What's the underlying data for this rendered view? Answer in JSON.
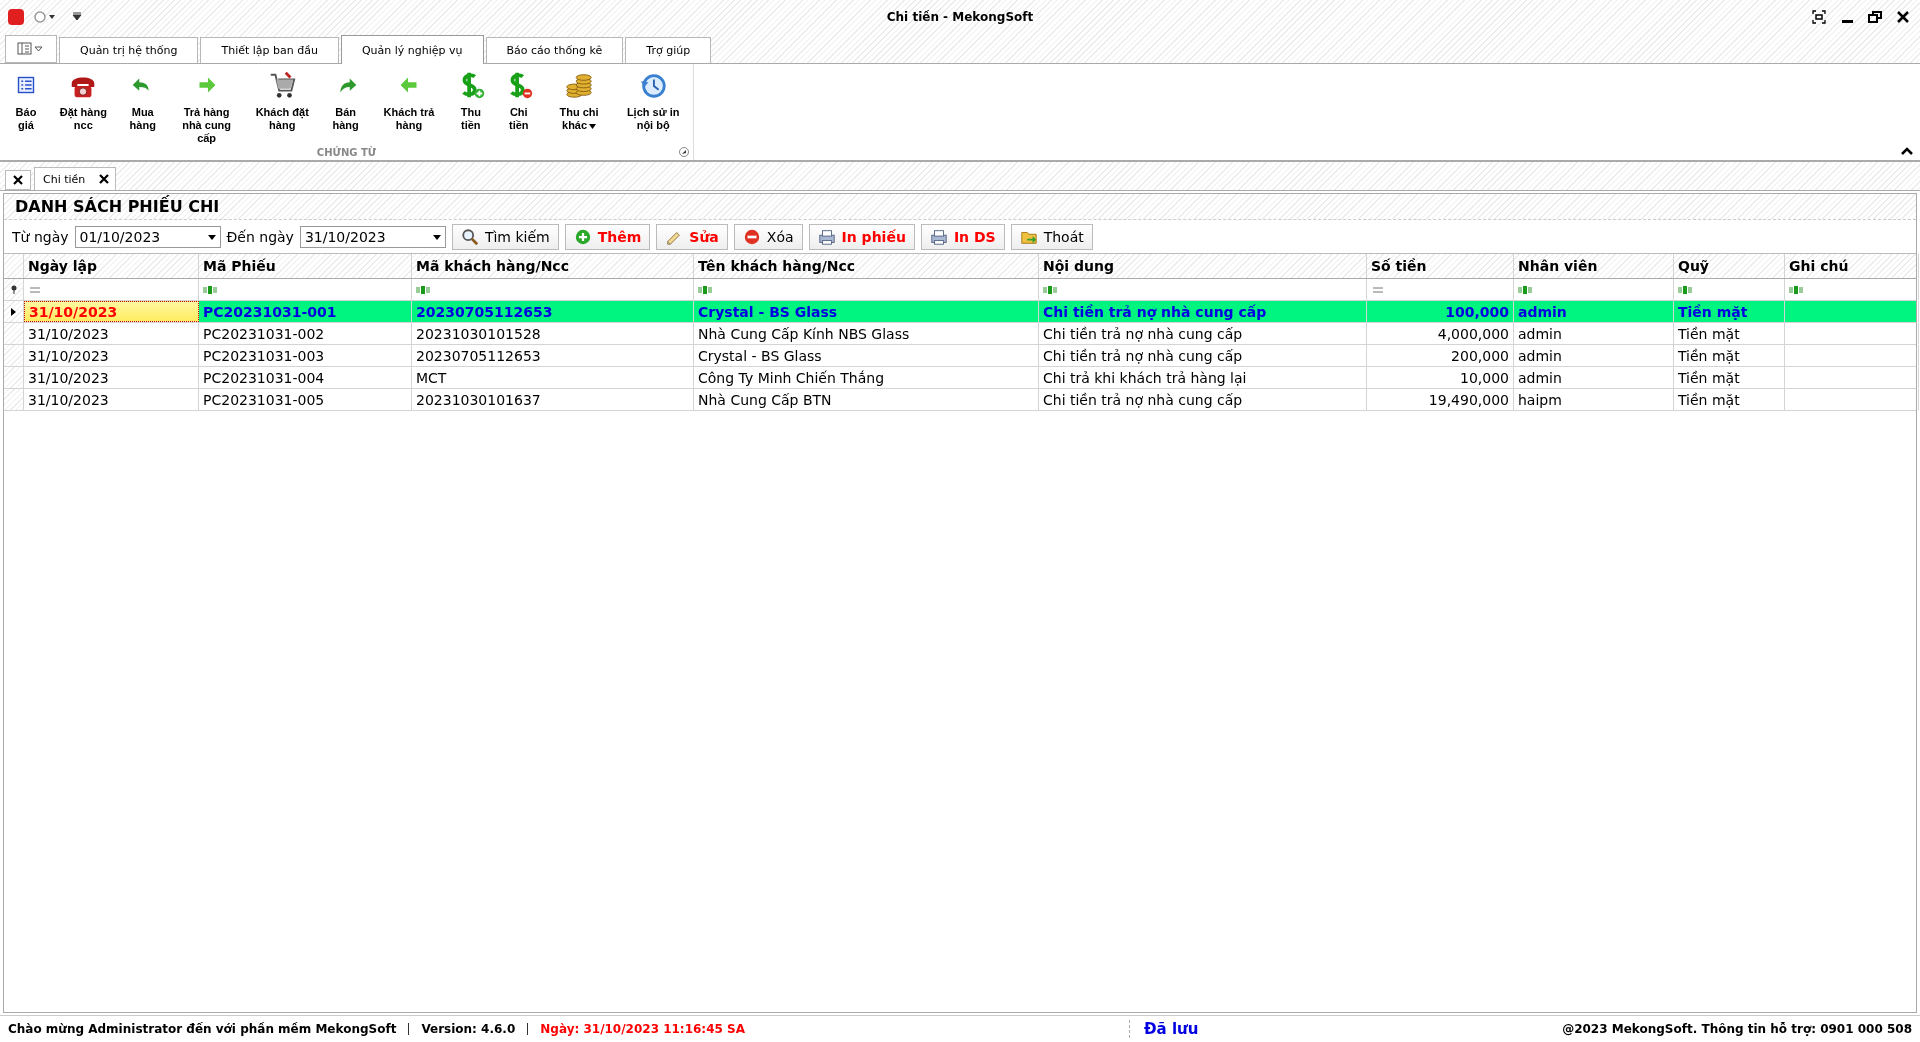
{
  "window": {
    "title": "Chi tiền - MekongSoft"
  },
  "ribbon_tabs": [
    {
      "label": "Quản trị hệ thống",
      "selected": false
    },
    {
      "label": "Thiết lập ban đầu",
      "selected": false
    },
    {
      "label": "Quản lý nghiệp vụ",
      "selected": true
    },
    {
      "label": "Báo cáo thống kê",
      "selected": false
    },
    {
      "label": "Trợ giúp",
      "selected": false
    }
  ],
  "ribbon_buttons": [
    {
      "label": "Báo giá",
      "kind": "list",
      "dropdown": false
    },
    {
      "label": "Đặt hàng ncc",
      "kind": "phone",
      "dropdown": false
    },
    {
      "label": "Mua hàng",
      "kind": "back",
      "dropdown": false
    },
    {
      "label": "Trả hàng nhà cung cấp",
      "kind": "right",
      "dropdown": false
    },
    {
      "label": "Khách đặt hàng",
      "kind": "cart",
      "dropdown": false
    },
    {
      "label": "Bán hàng",
      "kind": "forward",
      "dropdown": false
    },
    {
      "label": "Khách trả hàng",
      "kind": "left",
      "dropdown": false
    },
    {
      "label": "Thu tiền",
      "kind": "dollar-plus",
      "dropdown": false
    },
    {
      "label": "Chi tiền",
      "kind": "dollar-minus",
      "dropdown": false
    },
    {
      "label": "Thu chi khác",
      "kind": "coins",
      "dropdown": true
    },
    {
      "label": "Lịch sử in nội bộ",
      "kind": "history",
      "dropdown": false
    }
  ],
  "ribbon_group": "CHỨNG TỪ",
  "doc_tabs": [
    {
      "label": "Chi tiền",
      "selected": true
    }
  ],
  "panel": {
    "title": "DANH SÁCH PHIẾU CHI",
    "from_label": "Từ ngày",
    "from_value": "01/10/2023",
    "to_label": "Đến ngày",
    "to_value": "31/10/2023",
    "buttons": [
      {
        "label": "Tìm kiếm",
        "kind": "search",
        "color": "#000000"
      },
      {
        "label": "Thêm",
        "kind": "add",
        "color": "#ff0000"
      },
      {
        "label": "Sửa",
        "kind": "edit",
        "color": "#ff0000"
      },
      {
        "label": "Xóa",
        "kind": "delete",
        "color": "#000000"
      },
      {
        "label": "In phiếu",
        "kind": "print",
        "color": "#ff0000"
      },
      {
        "label": "In DS",
        "kind": "print",
        "color": "#ff0000"
      },
      {
        "label": "Thoát",
        "kind": "exit",
        "color": "#000000"
      }
    ]
  },
  "table": {
    "columns": [
      {
        "label": "Ngày lập",
        "kind": "date"
      },
      {
        "label": "Mã Phiếu",
        "kind": "text"
      },
      {
        "label": "Mã khách hàng/Ncc",
        "kind": "text"
      },
      {
        "label": "Tên khách hàng/Ncc",
        "kind": "text"
      },
      {
        "label": "Nội dung",
        "kind": "text"
      },
      {
        "label": "Số tiền",
        "kind": "number"
      },
      {
        "label": "Nhân viên",
        "kind": "text"
      },
      {
        "label": "Quỹ",
        "kind": "text"
      },
      {
        "label": "Ghi chú",
        "kind": "text"
      }
    ],
    "rows": [
      {
        "selected": true,
        "cells": [
          "31/10/2023",
          "PC20231031-001",
          "20230705112653",
          "Crystal - BS Glass",
          "Chi tiền trả nợ nhà cung cấp",
          "100,000",
          "admin",
          "Tiền mặt"
        ]
      },
      {
        "selected": false,
        "cells": [
          "31/10/2023",
          "PC20231031-002",
          "20231030101528",
          "Nhà Cung Cấp Kính NBS Glass",
          "Chi tiền trả nợ nhà cung cấp",
          "4,000,000",
          "admin",
          "Tiền mặt"
        ]
      },
      {
        "selected": false,
        "cells": [
          "31/10/2023",
          "PC20231031-003",
          "20230705112653",
          "Crystal - BS Glass",
          "Chi tiền trả nợ nhà cung cấp",
          "200,000",
          "admin",
          "Tiền mặt"
        ]
      },
      {
        "selected": false,
        "cells": [
          "31/10/2023",
          "PC20231031-004",
          "MCT",
          "Công Ty Minh Chiến Thắng",
          "Chi trả khi khách trả hàng lại",
          "10,000",
          "admin",
          "Tiền mặt"
        ]
      },
      {
        "selected": false,
        "cells": [
          "31/10/2023",
          "PC20231031-005",
          "20231030101637",
          "Nhà Cung Cấp BTN",
          "Chi tiền trả nợ nhà cung cấp",
          "19,490,000",
          "haipm",
          "Tiền mặt"
        ]
      }
    ]
  },
  "status_bar": {
    "welcome": "Chào mừng Administrator đến với phần mềm MekongSoft",
    "version": "Version: 4.6.0",
    "date": "Ngày: 31/10/2023 11:16:45 SA",
    "saved": "Đã lưu",
    "support": "@2023 MekongSoft. Thông tin hỗ trợ: 0901 000 508"
  }
}
